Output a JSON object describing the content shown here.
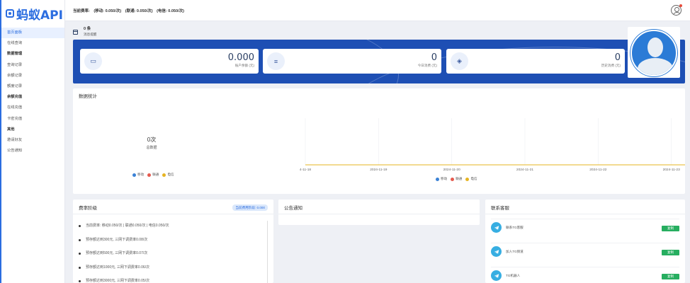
{
  "brand": {
    "name": "蚂蚁API"
  },
  "sidebar": {
    "items": [
      {
        "label": "首页面板",
        "active": true,
        "section": false
      },
      {
        "label": "在线查询",
        "active": false,
        "section": false
      },
      {
        "label": "数据管理",
        "active": false,
        "section": true
      },
      {
        "label": "查询记录",
        "active": false,
        "section": false
      },
      {
        "label": "余额记录",
        "active": false,
        "section": false
      },
      {
        "label": "额度记录",
        "active": false,
        "section": false
      },
      {
        "label": "余额充值",
        "active": false,
        "section": true
      },
      {
        "label": "在线充值",
        "active": false,
        "section": false
      },
      {
        "label": "卡密充值",
        "active": false,
        "section": false
      },
      {
        "label": "其他",
        "active": false,
        "section": true
      },
      {
        "label": "邀请好友",
        "active": false,
        "section": false
      },
      {
        "label": "公告通知",
        "active": false,
        "section": false
      }
    ]
  },
  "topbar": {
    "rate_title": "当前费率:",
    "rate_mobile": "(移动: 0.050/次)",
    "rate_unicom": "(联通: 0.050/次)",
    "rate_telecom": "(电信: 0.050/次)"
  },
  "notice": {
    "count": "0 条",
    "label": "消息提醒"
  },
  "cards": [
    {
      "value": "0.000",
      "label": "账户余额 (元)",
      "icon": "card-icon"
    },
    {
      "value": "0",
      "label": "今日消费 (元)",
      "icon": "list-icon"
    },
    {
      "value": "0",
      "label": "历史消费 (元)",
      "icon": "layers-icon"
    }
  ],
  "stats": {
    "title": "数据统计",
    "pie_value": "0次",
    "pie_label": "总数据",
    "legend": [
      {
        "name": "移动",
        "color": "#3b82d6"
      },
      {
        "name": "联通",
        "color": "#e55a4e"
      },
      {
        "name": "电信",
        "color": "#e6b422"
      }
    ]
  },
  "chart_data": {
    "type": "line",
    "x": [
      "4-11-18",
      "2024-11-19",
      "2024-11-20",
      "2024-11-21",
      "2024-11-22",
      "2024-11-23",
      "2024-11-24"
    ],
    "series": [
      {
        "name": "移动",
        "values": [
          0,
          0,
          0,
          0,
          0,
          0,
          0
        ],
        "color": "#3b82d6"
      },
      {
        "name": "联通",
        "values": [
          0,
          0,
          0,
          0,
          0,
          0,
          0
        ],
        "color": "#e55a4e"
      },
      {
        "name": "电信",
        "values": [
          0,
          0,
          0,
          0,
          0,
          0,
          0
        ],
        "color": "#e6b422"
      }
    ],
    "grid": true
  },
  "tiers": {
    "title": "费率阶级",
    "badge": "当前费用阶段: 0.000",
    "items": [
      "当前费率: 移动0.050/次 | 联通0.050/次 | 电信0.050/次",
      "预存额达到300元, 三网下调费率0.08/次",
      "预存额达到500元, 三网下调费率0.07/次",
      "预存额达到1000元, 三网下调费率0.06/次",
      "预存额达到3000元, 三网下调费率0.05/次"
    ]
  },
  "announce": {
    "title": "公告通知"
  },
  "contact": {
    "title": "联系客服",
    "items": [
      {
        "name": "联系TG客服",
        "button": "复制"
      },
      {
        "name": "加入TG频道",
        "button": "复制"
      },
      {
        "name": "TG机器人",
        "button": "复制"
      }
    ]
  }
}
